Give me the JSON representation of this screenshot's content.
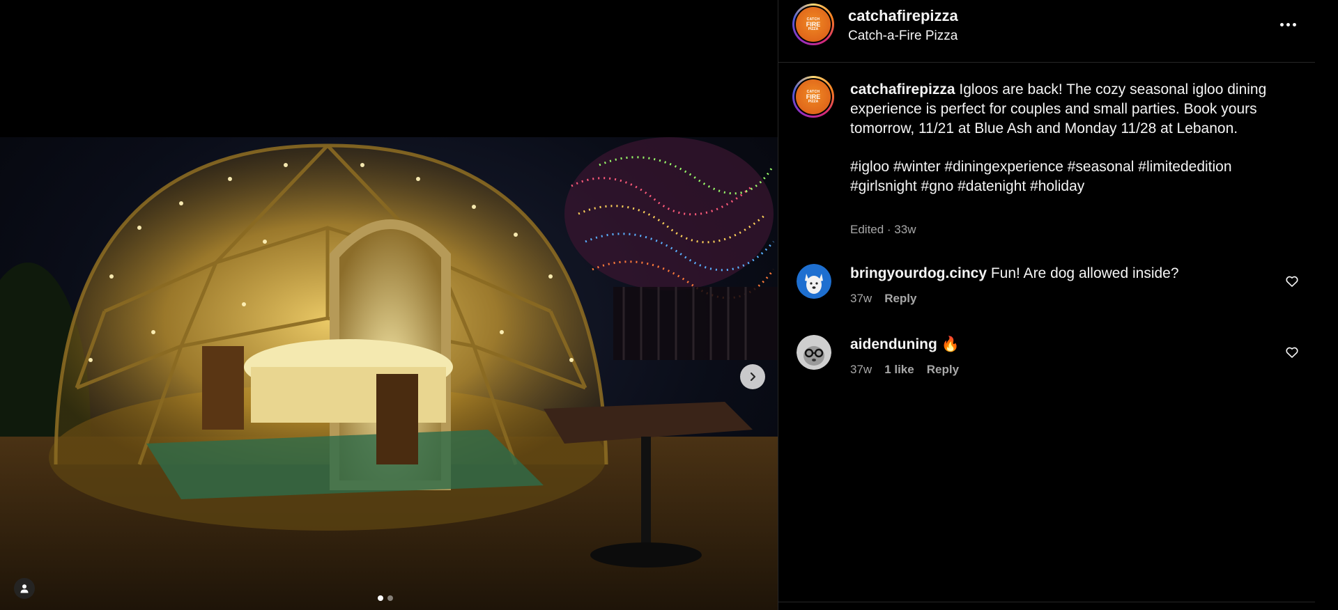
{
  "post": {
    "username": "catchafirepizza",
    "display_name": "Catch-a-Fire Pizza",
    "avatar_logo_lines": [
      "CATCH",
      "FIRE",
      "PIZZA"
    ],
    "more_icon": "more-horizontal-icon"
  },
  "caption": {
    "username": "catchafirepizza",
    "text": "Igloos are back! The cozy seasonal igloo dining experience is perfect for couples and small parties. Book yours tomorrow, 11/21 at Blue Ash and Monday 11/28 at Lebanon.",
    "hashtags": "#igloo #winter #diningexperience #seasonal #limitededition #girlsnight #gno #datenight #holiday",
    "meta": "Edited · 33w"
  },
  "comments": [
    {
      "username": "bringyourdog.cincy",
      "text": "Fun! Are dog allowed inside?",
      "time": "37w",
      "likes": "",
      "reply": "Reply"
    },
    {
      "username": "aidenduning",
      "text": "🔥",
      "time": "37w",
      "likes": "1 like",
      "reply": "Reply"
    }
  ],
  "media": {
    "slide_count": 2,
    "active_slide": 1,
    "next_icon": "chevron-right-icon",
    "tag_icon": "person-tag-icon"
  },
  "colors": {
    "background": "#000000",
    "text": "#f5f5f5",
    "secondary_text": "#a8a8a8",
    "divider": "#262626",
    "brand_orange": "#e0671a"
  }
}
